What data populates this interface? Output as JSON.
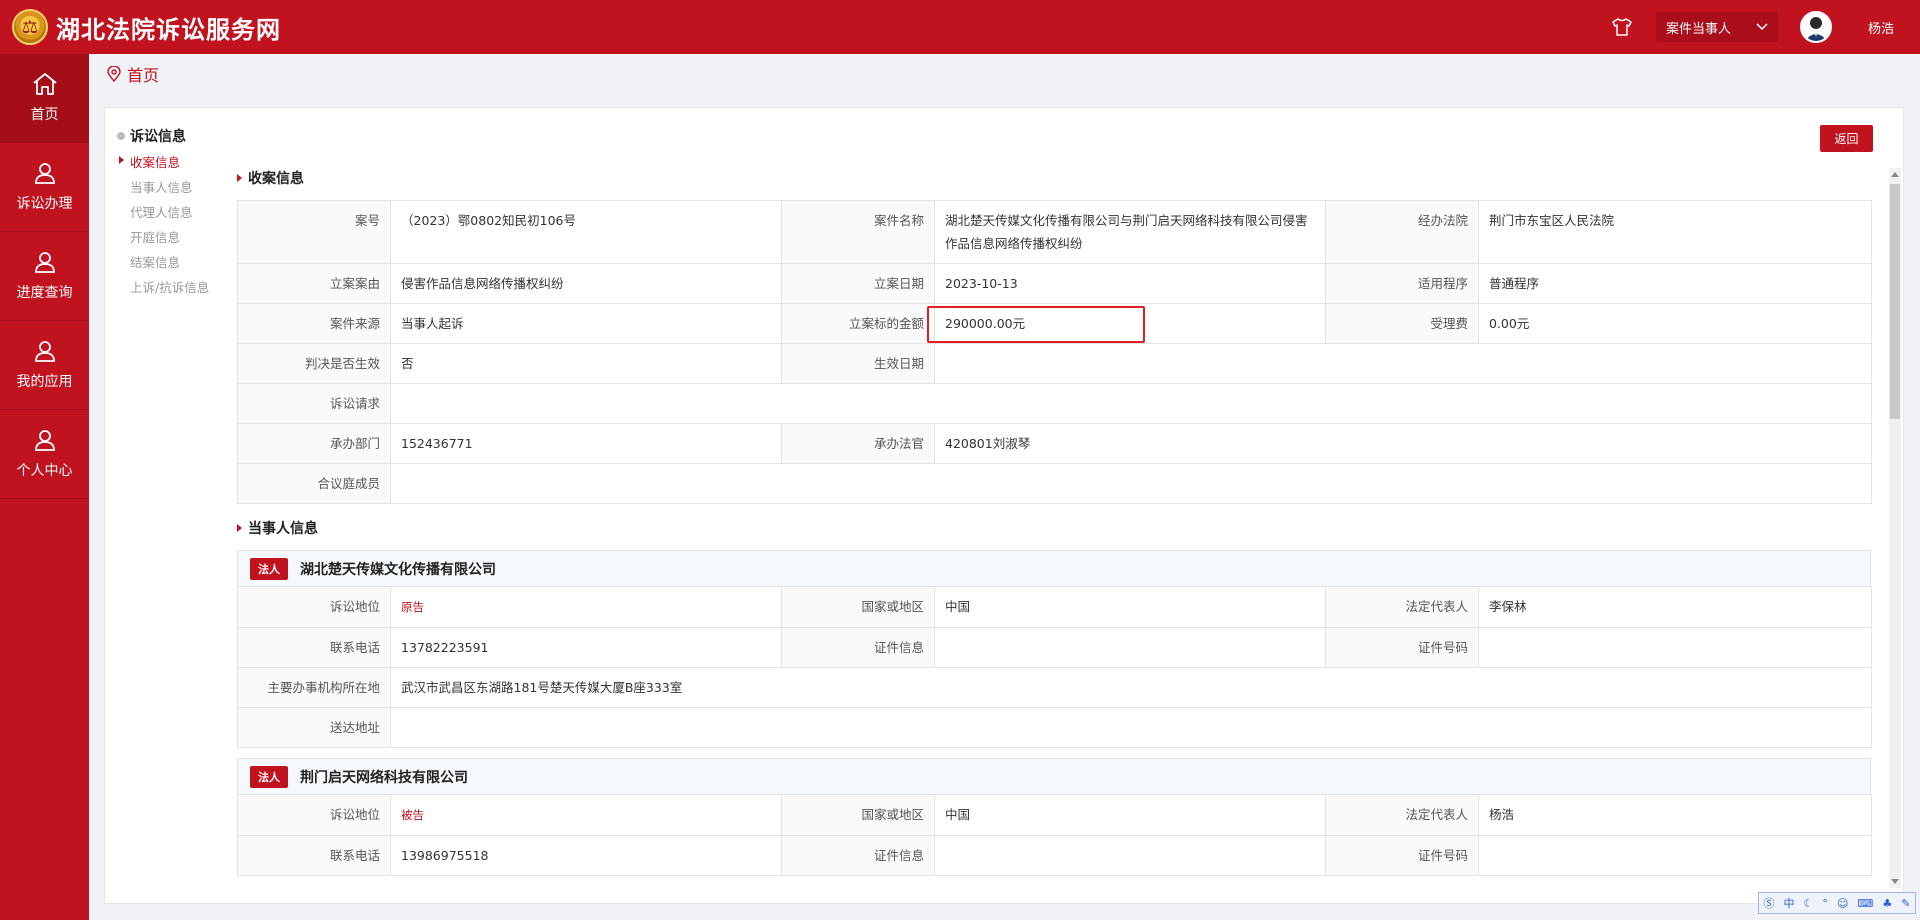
{
  "header": {
    "site_title": "湖北法院诉讼服务网",
    "role_select": "案件当事人",
    "username": "杨浩"
  },
  "sidebar": {
    "items": [
      {
        "label": "首页",
        "icon": "home-icon"
      },
      {
        "label": "诉讼办理",
        "icon": "user-icon"
      },
      {
        "label": "进度查询",
        "icon": "user-icon"
      },
      {
        "label": "我的应用",
        "icon": "user-icon"
      },
      {
        "label": "个人中心",
        "icon": "user-icon"
      }
    ]
  },
  "breadcrumb": {
    "current": "首页"
  },
  "panel": {
    "back_label": "返回",
    "anchor_nav": {
      "head": "诉讼信息",
      "items": [
        "收案信息",
        "当事人信息",
        "代理人信息",
        "开庭信息",
        "结案信息",
        "上诉/抗诉信息"
      ]
    }
  },
  "case": {
    "section_title": "收案信息",
    "case_no_label": "案号",
    "case_no": "（2023）鄂0802知民初106号",
    "case_name_label": "案件名称",
    "case_name": "湖北楚天传媒文化传播有限公司与荆门启天网络科技有限公司侵害作品信息网络传播权纠纷",
    "court_label": "经办法院",
    "court": "荆门市东宝区人民法院",
    "cause_label": "立案案由",
    "cause": "侵害作品信息网络传播权纠纷",
    "filing_date_label": "立案日期",
    "filing_date": "2023-10-13",
    "procedure_label": "适用程序",
    "procedure": "普通程序",
    "source_label": "案件来源",
    "source": "当事人起诉",
    "amount_label": "立案标的金额",
    "amount": "290000.00元",
    "fee_label": "受理费",
    "fee": "0.00元",
    "effective_label": "判决是否生效",
    "effective": "否",
    "effective_date_label": "生效日期",
    "effective_date": "",
    "claim_label": "诉讼请求",
    "claim": "",
    "dept_label": "承办部门",
    "dept": "152436771",
    "judge_label": "承办法官",
    "judge": "420801刘淑琴",
    "panel_label": "合议庭成员",
    "panel_members": ""
  },
  "parties": {
    "section_title": "当事人信息",
    "list": [
      {
        "badge": "法人",
        "name": "湖北楚天传媒文化传播有限公司",
        "role_label": "诉讼地位",
        "role": "原告",
        "country_label": "国家或地区",
        "country": "中国",
        "rep_label": "法定代表人",
        "rep": "李保林",
        "phone_label": "联系电话",
        "phone": "13782223591",
        "cert_label": "证件信息",
        "cert": "",
        "cert_no_label": "证件号码",
        "cert_no": "",
        "office_label": "主要办事机构所在地",
        "office": "武汉市武昌区东湖路181号楚天传媒大厦B座333室",
        "address_label": "送达地址",
        "address": ""
      },
      {
        "badge": "法人",
        "name": "荆门启天网络科技有限公司",
        "role_label": "诉讼地位",
        "role": "被告",
        "country_label": "国家或地区",
        "country": "中国",
        "rep_label": "法定代表人",
        "rep": "杨浩",
        "phone_label": "联系电话",
        "phone": "13986975518",
        "cert_label": "证件信息",
        "cert": "",
        "cert_no_label": "证件号码",
        "cert_no": ""
      }
    ]
  },
  "ime": {
    "label": "中"
  }
}
